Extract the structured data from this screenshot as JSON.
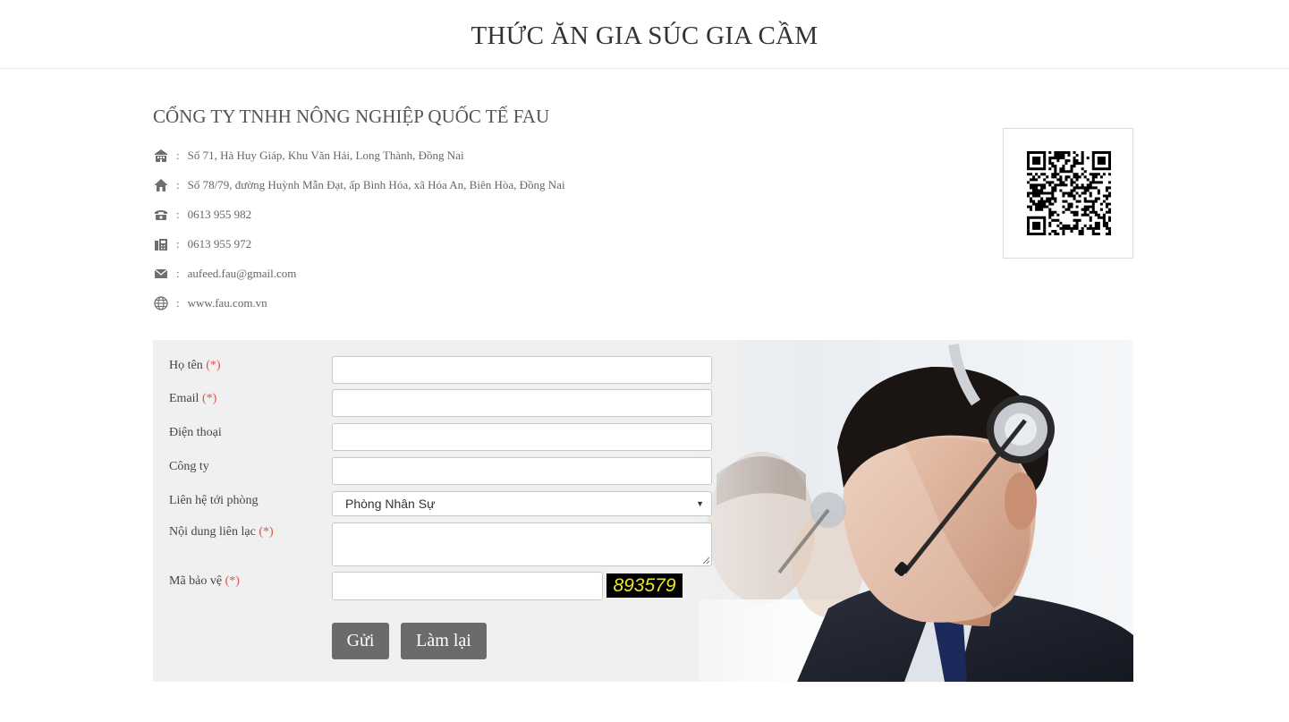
{
  "site": {
    "title": "THỨC ĂN GIA SÚC GIA CẦM"
  },
  "company": {
    "name": "CỔNG TY TNHH NÔNG NGHIỆP QUỐC TẾ FAU",
    "separator": ":",
    "info": [
      {
        "icon": "office-building-icon",
        "text": "Số 71, Hà Huy Giáp, Khu Văn Hải, Long Thành, Đồng Nai"
      },
      {
        "icon": "home-icon",
        "text": "Số 78/79, đường Huỳnh Mẫn Đạt, ấp Bình Hóa, xã Hóa An, Biên Hòa, Đồng Nai"
      },
      {
        "icon": "phone-icon",
        "text": "0613 955 982"
      },
      {
        "icon": "fax-icon",
        "text": "0613 955 972"
      },
      {
        "icon": "envelope-icon",
        "text": "aufeed.fau@gmail.com"
      },
      {
        "icon": "globe-icon",
        "text": "www.fau.com.vn"
      }
    ]
  },
  "form": {
    "required_mark": "(*)",
    "fields": {
      "name": {
        "label": "Họ tên",
        "value": ""
      },
      "email": {
        "label": "Email",
        "value": ""
      },
      "phone": {
        "label": "Điện thoại",
        "value": ""
      },
      "company": {
        "label": "Công ty",
        "value": ""
      },
      "department": {
        "label": "Liên hệ tới phòng",
        "selected": "Phòng Nhân Sự"
      },
      "message": {
        "label": "Nội dung liên lạc",
        "value": ""
      },
      "captcha": {
        "label": "Mã bảo vệ",
        "value": "",
        "code": "893579"
      }
    },
    "buttons": {
      "send": "Gửi",
      "reset": "Làm lại"
    }
  },
  "colors": {
    "required": "#d9534f",
    "button_bg": "#6b6b6b",
    "panel_bg": "#f0f0f0",
    "captcha_text": "#e8e823"
  }
}
